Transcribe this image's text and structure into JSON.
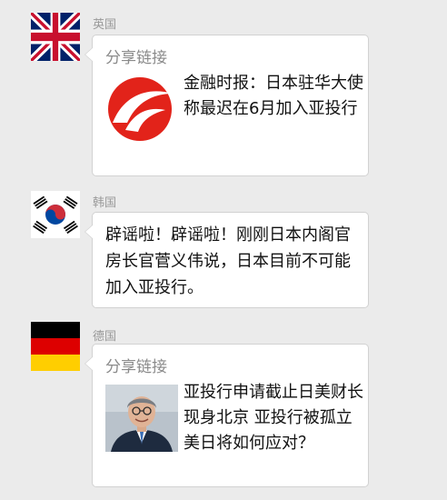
{
  "messages": [
    {
      "sender": "英国",
      "flag": "uk-flag",
      "type": "share",
      "share_label": "分享链接",
      "thumb_icon": "financial-times-cn-logo-icon",
      "title": "金融时报：日本驻华大使称最迟在6月加入亚投行"
    },
    {
      "sender": "韩国",
      "flag": "korea-flag",
      "type": "text",
      "text": "辟谣啦！辟谣啦！刚刚日本内阁官房长官菅义伟说，日本目前不可能加入亚投行。"
    },
    {
      "sender": "德国",
      "flag": "germany-flag",
      "type": "share",
      "share_label": "分享链接",
      "thumb_icon": "man-portrait-photo",
      "title": "亚投行申请截止日美财长现身北京 亚投行被孤立美日将如何应对？"
    }
  ],
  "colors": {
    "background": "#ebebeb",
    "bubble": "#ffffff",
    "sender_name": "#999999",
    "logo_red": "#e2231a"
  }
}
